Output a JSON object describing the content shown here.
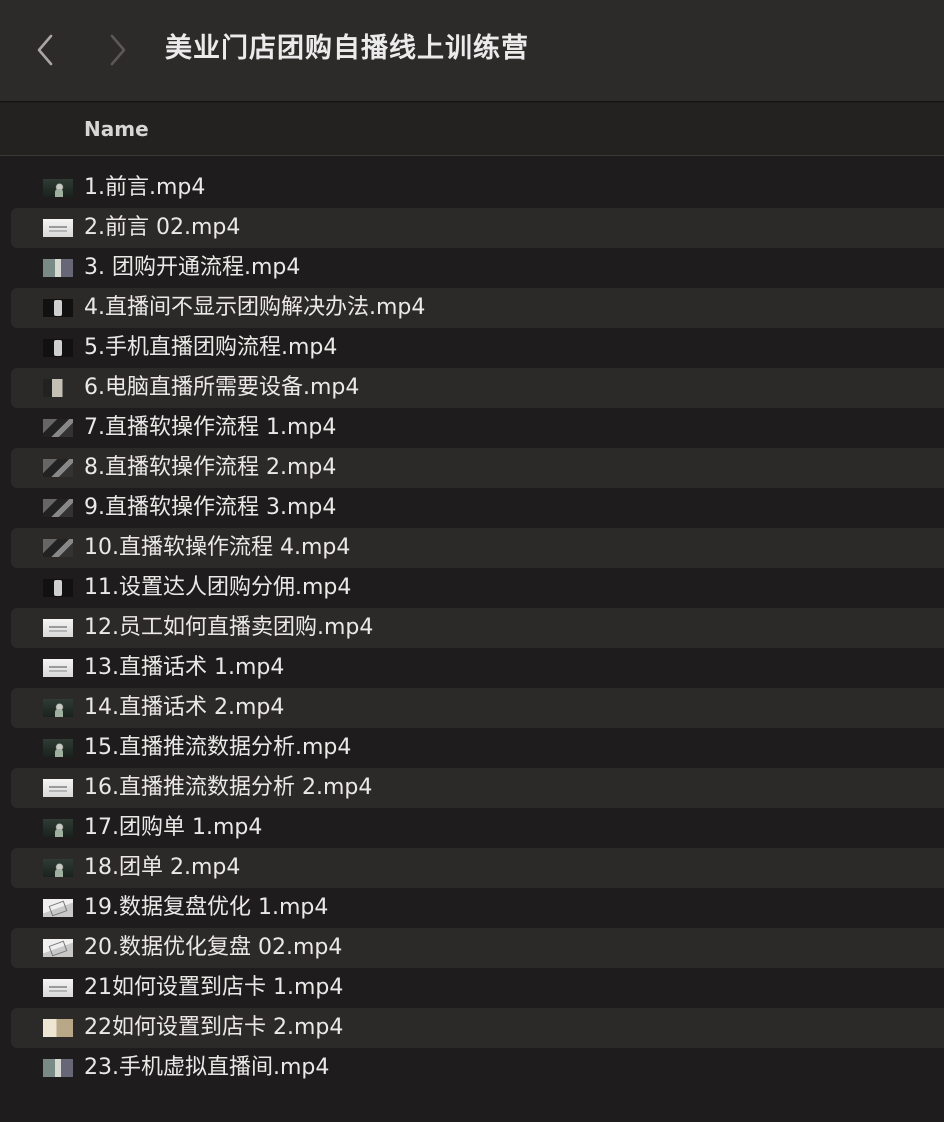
{
  "window": {
    "title": "美业门店团购自播线上训练营",
    "back_icon": "chevron-left-icon",
    "forward_icon": "chevron-right-icon"
  },
  "columns": {
    "name": "Name"
  },
  "files": [
    {
      "name": "1.前言.mp4",
      "thumb": "person"
    },
    {
      "name": "2.前言 02.mp4",
      "thumb": "white"
    },
    {
      "name": "3. 团购开通流程.mp4",
      "thumb": "screen"
    },
    {
      "name": "4.直播间不显示团购解决办法.mp4",
      "thumb": "phone"
    },
    {
      "name": "5.手机直播团购流程.mp4",
      "thumb": "phone"
    },
    {
      "name": "6.电脑直播所需要设备.mp4",
      "thumb": "mixed"
    },
    {
      "name": "7.直播软操作流程 1.mp4",
      "thumb": "dark"
    },
    {
      "name": "8.直播软操作流程 2.mp4",
      "thumb": "dark"
    },
    {
      "name": "9.直播软操作流程 3.mp4",
      "thumb": "dark"
    },
    {
      "name": "10.直播软操作流程 4.mp4",
      "thumb": "dark"
    },
    {
      "name": "11.设置达人团购分佣.mp4",
      "thumb": "phone"
    },
    {
      "name": "12.员工如何直播卖团购.mp4",
      "thumb": "white"
    },
    {
      "name": "13.直播话术 1.mp4",
      "thumb": "white"
    },
    {
      "name": "14.直播话术 2.mp4",
      "thumb": "person"
    },
    {
      "name": "15.直播推流数据分析.mp4",
      "thumb": "person"
    },
    {
      "name": "16.直播推流数据分析 2.mp4",
      "thumb": "white"
    },
    {
      "name": "17.团购单 1.mp4",
      "thumb": "person"
    },
    {
      "name": "18.团单 2.mp4",
      "thumb": "person"
    },
    {
      "name": "19.数据复盘优化 1.mp4",
      "thumb": "doc"
    },
    {
      "name": "20.数据优化复盘 02.mp4",
      "thumb": "doc"
    },
    {
      "name": "21如何设置到店卡 1.mp4",
      "thumb": "white"
    },
    {
      "name": "22如何设置到店卡 2.mp4",
      "thumb": "menu"
    },
    {
      "name": "23.手机虚拟直播间.mp4",
      "thumb": "screen"
    }
  ],
  "colors": {
    "background": "#1e1c1c",
    "titlebar": "#2d2a2a",
    "row_alt": "#2c2929",
    "text": "#ebe9e8"
  }
}
